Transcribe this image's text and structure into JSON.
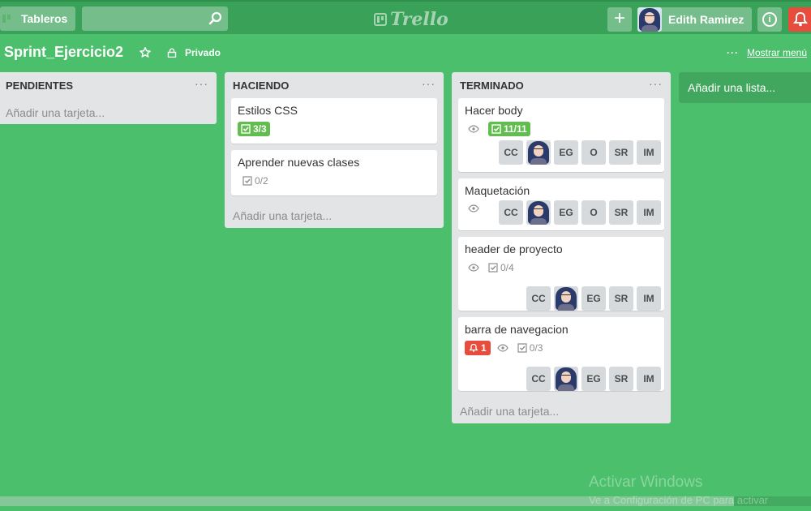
{
  "header": {
    "boards_label": "Tableros",
    "logo_text": "Trello",
    "user_name": "Edith Ramirez",
    "add_label": "+"
  },
  "board": {
    "title": "Sprint_Ejercicio2",
    "visibility": "Privado",
    "menu_label": "Mostrar menú",
    "add_list_label": "Añadir una lista..."
  },
  "lists": [
    {
      "title": "PENDIENTES",
      "add_card_label": "Añadir una tarjeta...",
      "cards": []
    },
    {
      "title": "HACIENDO",
      "add_card_label": "Añadir una tarjeta...",
      "cards": [
        {
          "title": "Estilos CSS",
          "checklist": "3/3",
          "complete": true
        },
        {
          "title": "Aprender nuevas clases",
          "checklist": "0/2",
          "complete": false
        }
      ]
    },
    {
      "title": "TERMINADO",
      "add_card_label": "Añadir una tarjeta...",
      "cards": [
        {
          "title": "Hacer body",
          "checklist": "11/11",
          "complete": true,
          "members": [
            "CC",
            "photo",
            "EG",
            "O",
            "SR",
            "IM"
          ]
        },
        {
          "title": "Maquetación",
          "members": [
            "CC",
            "photo",
            "EG",
            "O",
            "SR",
            "IM"
          ]
        },
        {
          "title": "header de proyecto",
          "checklist": "0/4",
          "complete": false,
          "members": [
            "CC",
            "photo",
            "EG",
            "SR",
            "IM"
          ]
        },
        {
          "title": "barra de navegacion",
          "notifications": "1",
          "checklist": "0/3",
          "complete": false,
          "members": [
            "CC",
            "photo",
            "EG",
            "SR",
            "IM"
          ]
        }
      ]
    }
  ],
  "watermark": {
    "title": "Activar Windows",
    "subtitle": "Ve a Configuración de PC para activar"
  },
  "colors": {
    "board_bg": "#4bbf6b",
    "header_bg": "#3aa158",
    "list_bg": "#e2e4e6",
    "checklist_done": "#61bd4f",
    "alert": "#e74c3c"
  }
}
